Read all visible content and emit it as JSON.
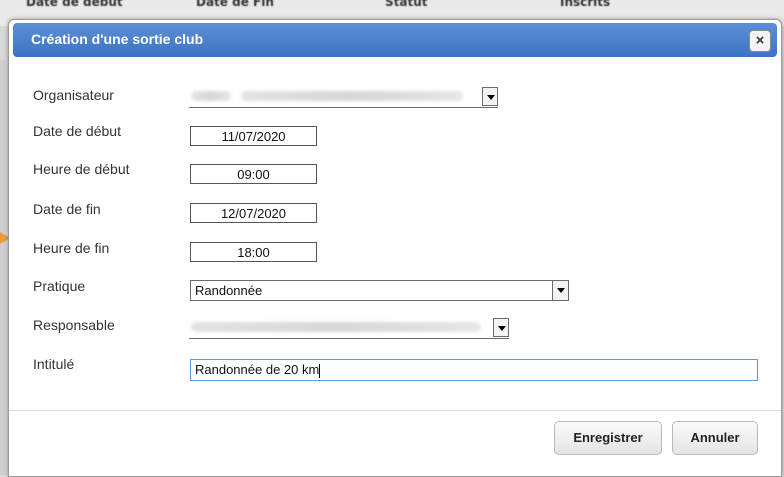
{
  "background": {
    "col_headers": [
      "Date de début",
      "Date de Fin",
      "Statut",
      "Inscrits"
    ]
  },
  "dialog": {
    "title": "Création d'une sortie club",
    "close_label": "×",
    "fields": {
      "organisateur_label": "Organisateur",
      "date_debut_label": "Date de début",
      "date_debut_value": "11/07/2020",
      "heure_debut_label": "Heure de début",
      "heure_debut_value": "09:00",
      "date_fin_label": "Date de fin",
      "date_fin_value": "12/07/2020",
      "heure_fin_label": "Heure de fin",
      "heure_fin_value": "18:00",
      "pratique_label": "Pratique",
      "pratique_value": "Randonnée",
      "responsable_label": "Responsable",
      "intitule_label": "Intitulé",
      "intitule_value": "Randonnée de 20 km"
    },
    "buttons": {
      "save": "Enregistrer",
      "cancel": "Annuler"
    }
  },
  "colors": {
    "titlebar": "#4a7fcc",
    "accent_arrow": "#f29a3b",
    "focus_border": "#5b9bd5"
  }
}
